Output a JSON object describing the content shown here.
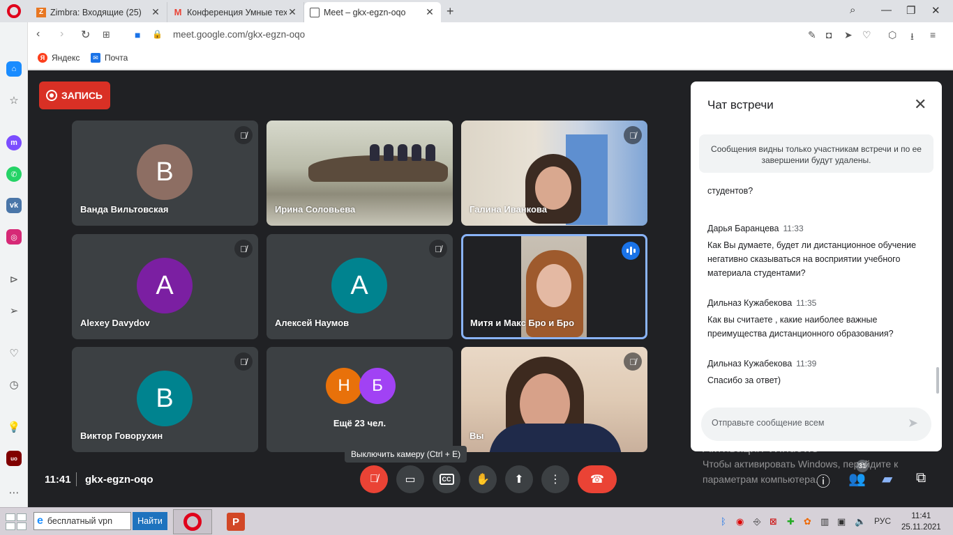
{
  "browser": {
    "tabs": [
      {
        "title": "Zimbra: Входящие (25)",
        "favicon": "zimbra-icon",
        "color": "#e87722"
      },
      {
        "title": "Конференция Умные техн",
        "favicon": "gmail-icon",
        "color": "#ea4335"
      },
      {
        "title": "Meet – gkx-egzn-oqo",
        "favicon": "meet-icon",
        "color": "#1a73e8"
      }
    ],
    "url": "meet.google.com/gkx-egzn-oqo",
    "bookmarks": [
      {
        "label": "Яндекс",
        "icon": "yandex-icon",
        "color": "#fc3f1d",
        "glyph": "Я"
      },
      {
        "label": "Почта",
        "icon": "mail-icon",
        "color": "#1a73e8",
        "glyph": "✉"
      }
    ],
    "sidebar_icons": [
      "home-icon",
      "bookmark-icon",
      "messenger-icon",
      "whatsapp-icon",
      "vk-icon",
      "instagram-icon",
      "player-icon",
      "send-icon",
      "heart-icon",
      "history-icon",
      "tips-icon",
      "ublock-icon",
      "more-icon"
    ]
  },
  "meet": {
    "record_label": "ЗАПИСЬ",
    "time": "11:41",
    "code": "gkx-egzn-oqo",
    "tooltip": "Выключить камеру (Ctrl + E)",
    "people_count": "31",
    "tiles": [
      {
        "name": "Ванда Вильтовская",
        "initial": "В",
        "color": "#8d6e63"
      },
      {
        "name": "Ирина Соловьева"
      },
      {
        "name": "Галина Иванкова"
      },
      {
        "name": "Alexey Davydov",
        "initial": "A",
        "color": "#7b1fa2"
      },
      {
        "name": "Алексей Наумов",
        "initial": "А",
        "color": "#00838f"
      },
      {
        "name": "Митя и Макс Бро и Бро"
      },
      {
        "name": "Виктор Говорухин",
        "initial": "В",
        "color": "#00838f"
      },
      {
        "more": "Ещё 23 чел.",
        "initials": [
          "Н",
          "Б"
        ],
        "colors": [
          "#e8710a",
          "#a142f4"
        ]
      },
      {
        "name": "Вы"
      }
    ]
  },
  "chat": {
    "title": "Чат встречи",
    "notice": "Сообщения видны только участникам встречи и по ее завершении будут удалены.",
    "fragment": "студентов?",
    "messages": [
      {
        "author": "Дарья Баранцева",
        "time": "11:33",
        "text": "Как Вы думаете, будет ли дистанционное обучение негативно сказываться на восприятии учебного материала студентами?"
      },
      {
        "author": "Дильназ Кужабекова",
        "time": "11:35",
        "text": "Как вы считаете , какие наиболее важные преимущества дистанционного образования?"
      },
      {
        "author": "Дильназ Кужабекова",
        "time": "11:39",
        "text": "Спасибо за ответ)"
      }
    ],
    "input_placeholder": "Отправьте сообщение всем"
  },
  "watermark": {
    "line1": "Активация Windows",
    "line2": "Чтобы активировать Windows, перейдите к",
    "line3": "параметрам компьютера."
  },
  "taskbar": {
    "search_value": "бесплатный vpn",
    "search_button": "Найти",
    "lang": "РУС",
    "clock_time": "11:41",
    "clock_date": "25.11.2021"
  }
}
